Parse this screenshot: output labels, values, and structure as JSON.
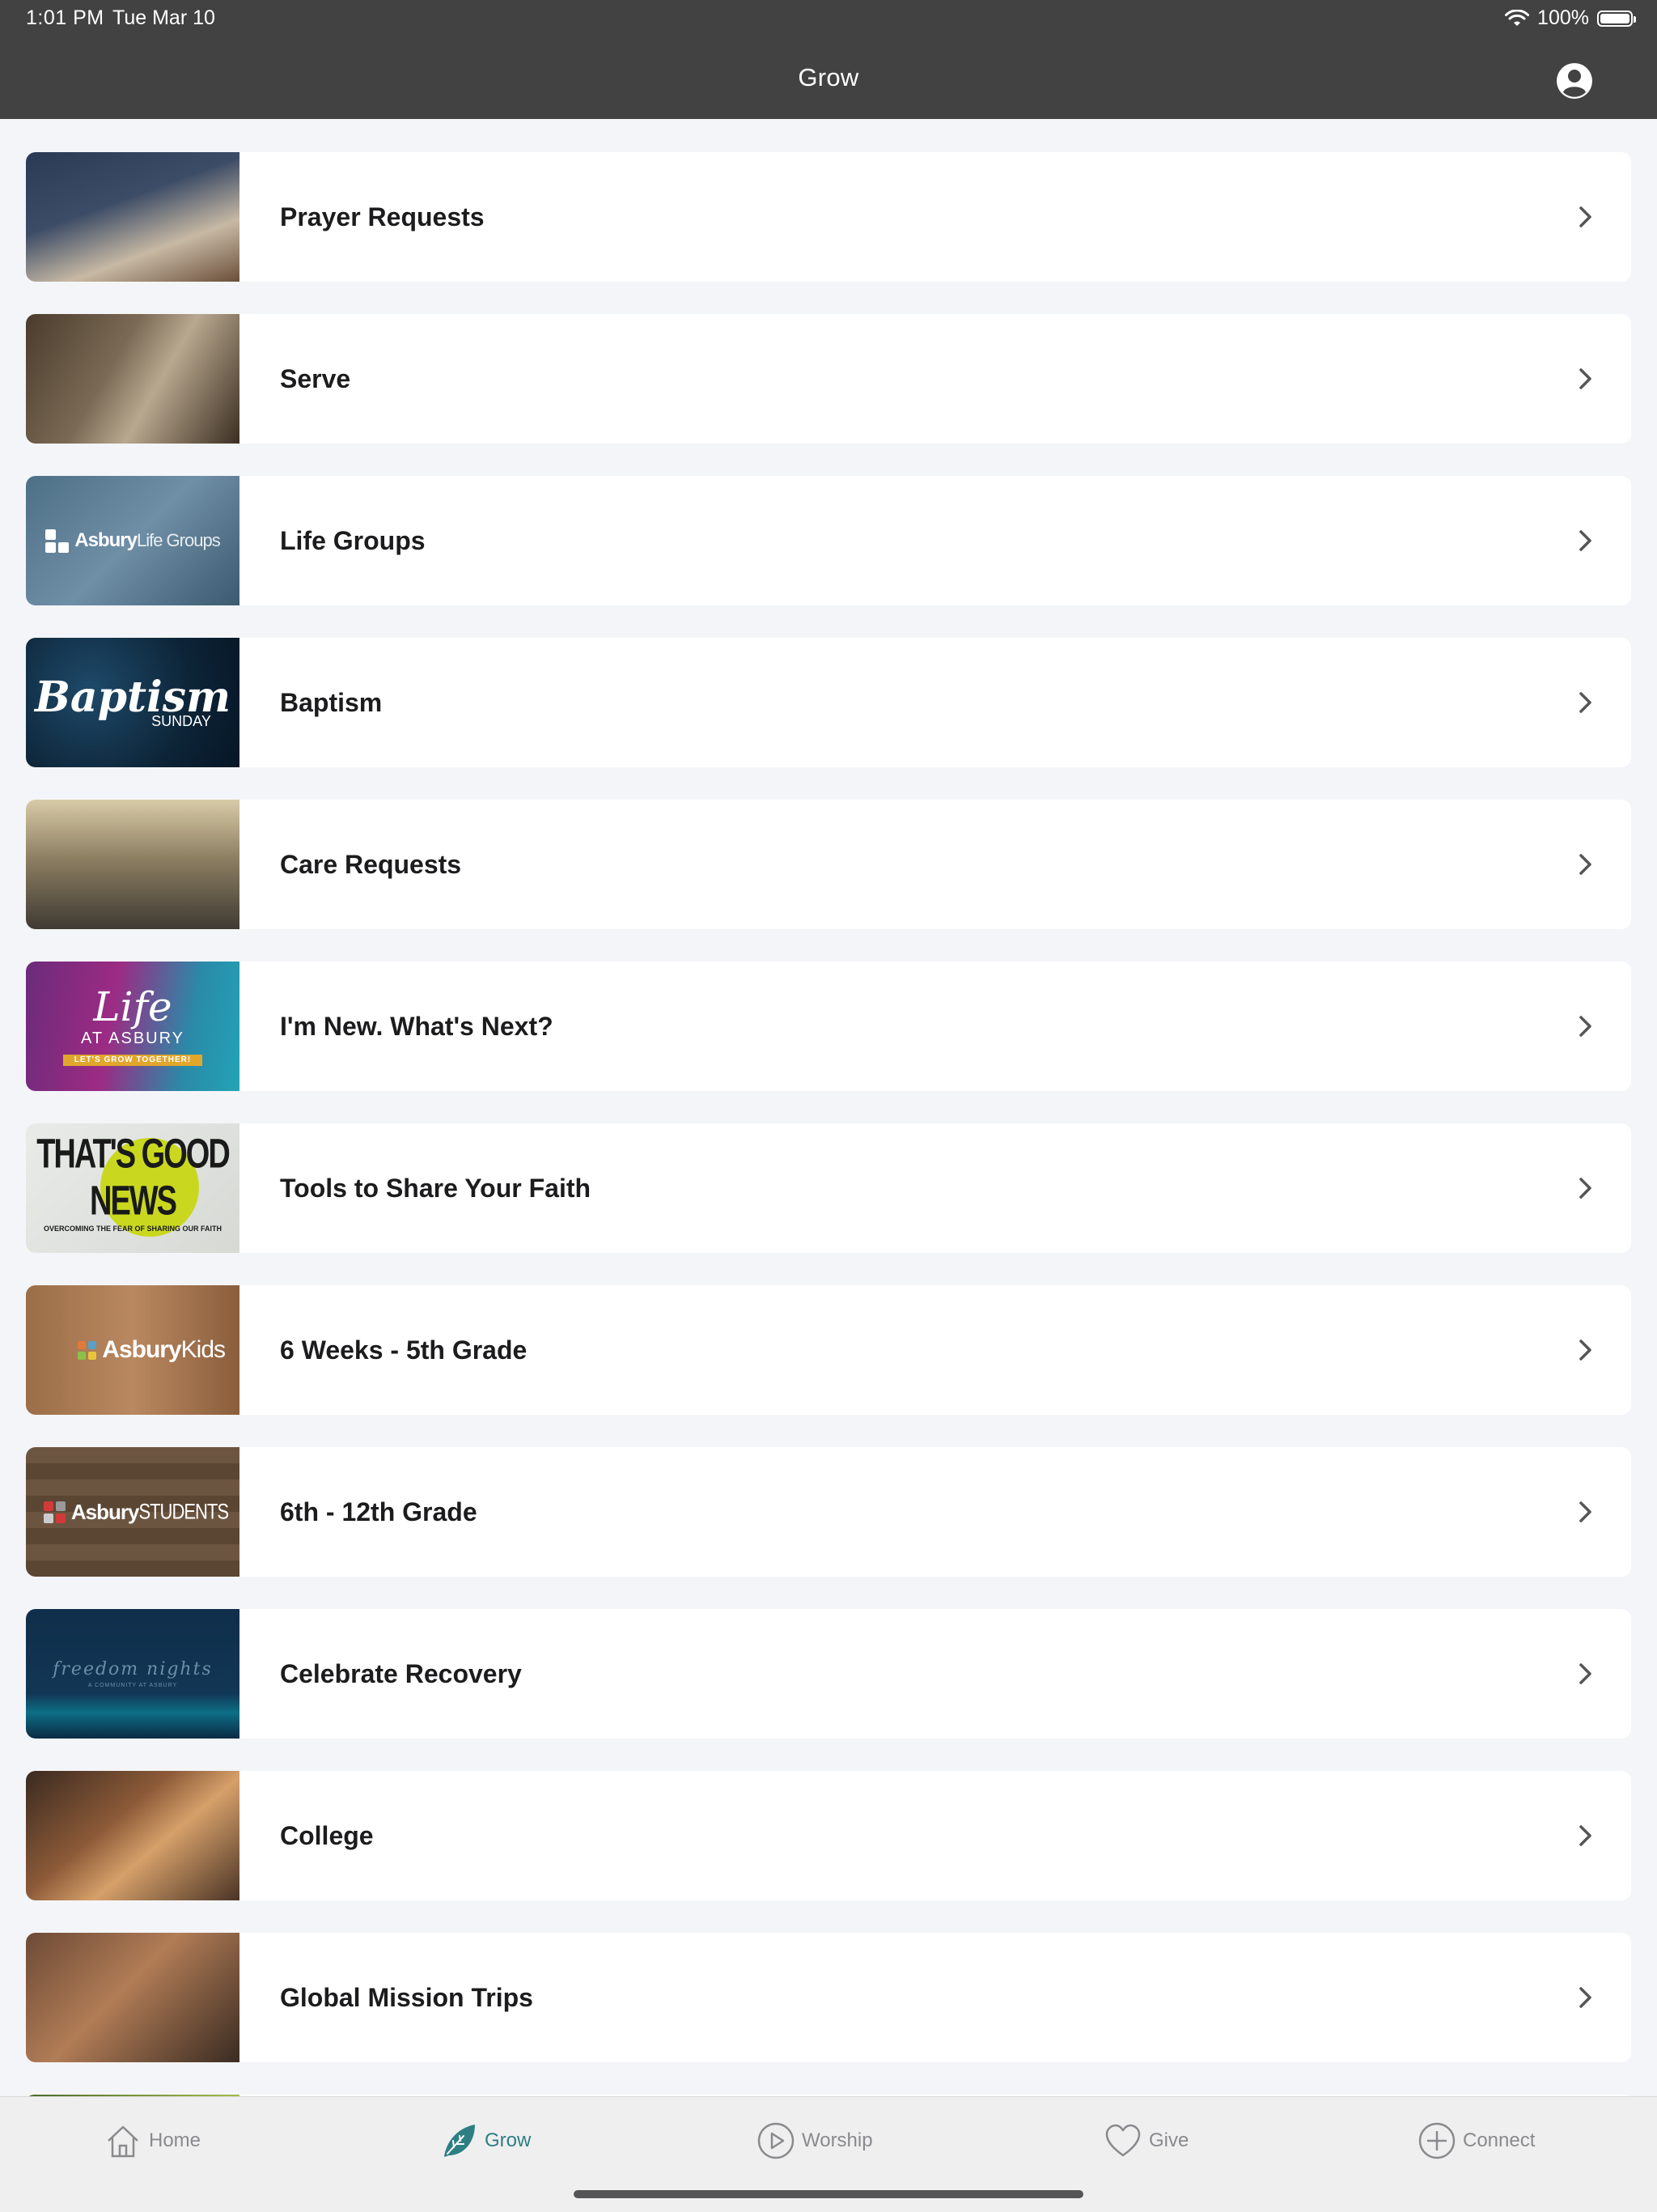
{
  "status_bar": {
    "time": "1:01 PM",
    "date": "Tue Mar 10",
    "battery_text": "100%"
  },
  "nav": {
    "title": "Grow",
    "profile_icon": "person-circle-icon"
  },
  "list": {
    "items": [
      {
        "label": "Prayer Requests",
        "thumbnail": "prayer-photo"
      },
      {
        "label": "Serve",
        "thumbnail": "serve-photo"
      },
      {
        "label": "Life Groups",
        "thumbnail": "life-groups-photo",
        "thumb_text": "Asbury",
        "thumb_text_light": "Life Groups"
      },
      {
        "label": "Baptism",
        "thumbnail": "baptism-graphic",
        "thumb_text": "Baptism",
        "thumb_sub": "SUNDAY"
      },
      {
        "label": "Care Requests",
        "thumbnail": "care-photo"
      },
      {
        "label": "I'm New. What's Next?",
        "thumbnail": "life-at-asbury-graphic",
        "thumb_script": "Life",
        "thumb_sub": "AT ASBURY",
        "thumb_tag": "LET'S GROW TOGETHER!"
      },
      {
        "label": "Tools to Share Your Faith",
        "thumbnail": "good-news-graphic",
        "thumb_text": "THAT'S GOOD NEWS",
        "thumb_sub": "OVERCOMING THE FEAR OF SHARING OUR FAITH"
      },
      {
        "label": "6 Weeks - 5th Grade",
        "thumbnail": "asbury-kids-graphic",
        "thumb_text": "Asbury",
        "thumb_text_light": "Kids"
      },
      {
        "label": "6th - 12th Grade",
        "thumbnail": "asbury-students-graphic",
        "thumb_text": "Asbury",
        "thumb_text_light": "STUDENTS"
      },
      {
        "label": "Celebrate Recovery",
        "thumbnail": "freedom-nights-graphic",
        "thumb_script": "freedom nights",
        "thumb_sub": "A COMMUNITY AT ASBURY"
      },
      {
        "label": "College",
        "thumbnail": "college-photo"
      },
      {
        "label": "Global Mission Trips",
        "thumbnail": "mission-photo"
      }
    ]
  },
  "tabbar": {
    "tabs": [
      {
        "label": "Home",
        "icon": "house-icon",
        "active": false
      },
      {
        "label": "Grow",
        "icon": "leaf-icon",
        "active": true
      },
      {
        "label": "Worship",
        "icon": "play-circle-icon",
        "active": false
      },
      {
        "label": "Give",
        "icon": "heart-icon",
        "active": false
      },
      {
        "label": "Connect",
        "icon": "plus-circle-icon",
        "active": false
      }
    ]
  },
  "colors": {
    "nav_background": "#424242",
    "page_background": "#f4f5f8",
    "active_tab": "#2e7f84",
    "inactive_tab": "#8a8a8e"
  }
}
